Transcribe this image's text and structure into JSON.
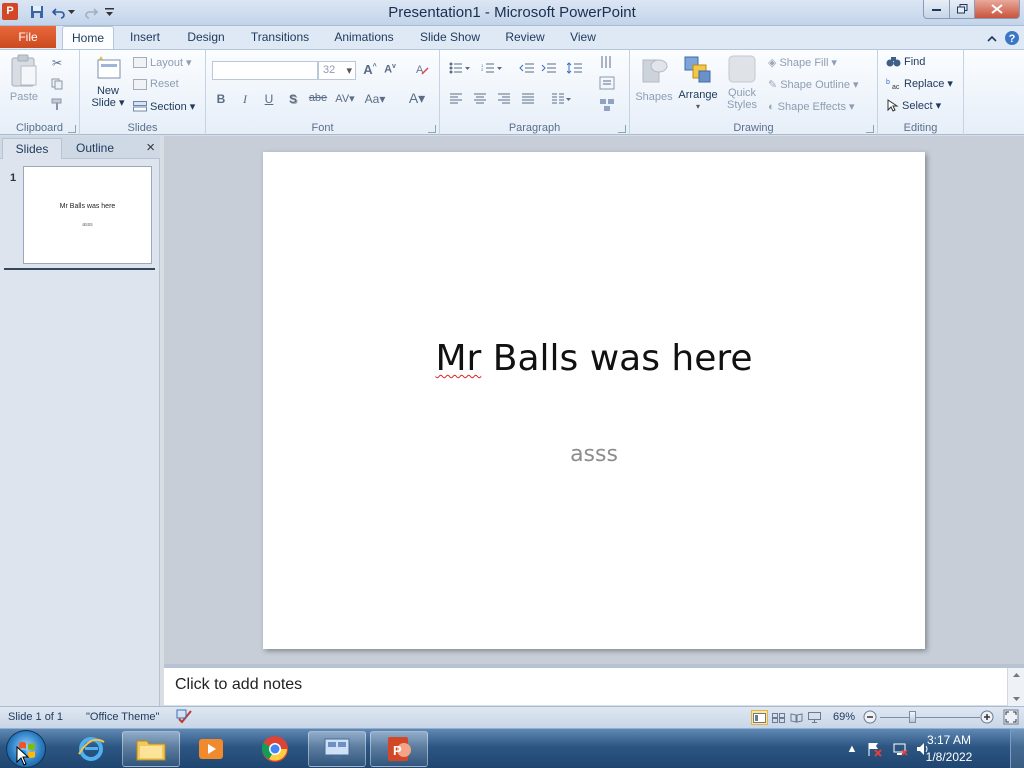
{
  "window": {
    "title": "Presentation1  -  Microsoft PowerPoint",
    "app_logo": "P"
  },
  "tabs": [
    "File",
    "Home",
    "Insert",
    "Design",
    "Transitions",
    "Animations",
    "Slide Show",
    "Review",
    "View"
  ],
  "ribbon": {
    "clipboard": {
      "paste": "Paste",
      "label": "Clipboard"
    },
    "slides": {
      "new_slide_line1": "New",
      "new_slide_line2": "Slide",
      "layout": "Layout",
      "reset": "Reset",
      "section": "Section",
      "label": "Slides"
    },
    "font": {
      "font_name": "",
      "font_size": "32",
      "label": "Font",
      "bold": "B",
      "italic": "I",
      "underline": "U",
      "shadow": "S",
      "strike": "abe",
      "spacing": "AV",
      "case": "Aa",
      "color": "A",
      "grow": "A",
      "shrink": "A"
    },
    "paragraph": {
      "label": "Paragraph"
    },
    "drawing": {
      "shapes": "Shapes",
      "arrange": "Arrange",
      "quick_styles_line1": "Quick",
      "quick_styles_line2": "Styles",
      "shape_fill": "Shape Fill",
      "shape_outline": "Shape Outline",
      "shape_effects": "Shape Effects",
      "label": "Drawing"
    },
    "editing": {
      "find": "Find",
      "replace": "Replace",
      "select": "Select",
      "label": "Editing"
    }
  },
  "pane": {
    "tab_slides": "Slides",
    "tab_outline": "Outline",
    "close": "×",
    "thumb_number": "1",
    "thumb_title": "Mr Balls was here",
    "thumb_subtitle": "asss"
  },
  "slide": {
    "title_word1": "Mr",
    "title_rest": " Balls was here",
    "subtitle": "asss"
  },
  "notes": {
    "placeholder": "Click to add notes"
  },
  "status": {
    "slide_info": "Slide 1 of 1",
    "theme": "\"Office Theme\"",
    "zoom": "69%",
    "zoom_level_percent": 69
  },
  "taskbar": {
    "time": "3:17 AM",
    "date": "1/8/2022"
  },
  "colors": {
    "file_tab": "#d24726",
    "accent": "#2b579a"
  }
}
